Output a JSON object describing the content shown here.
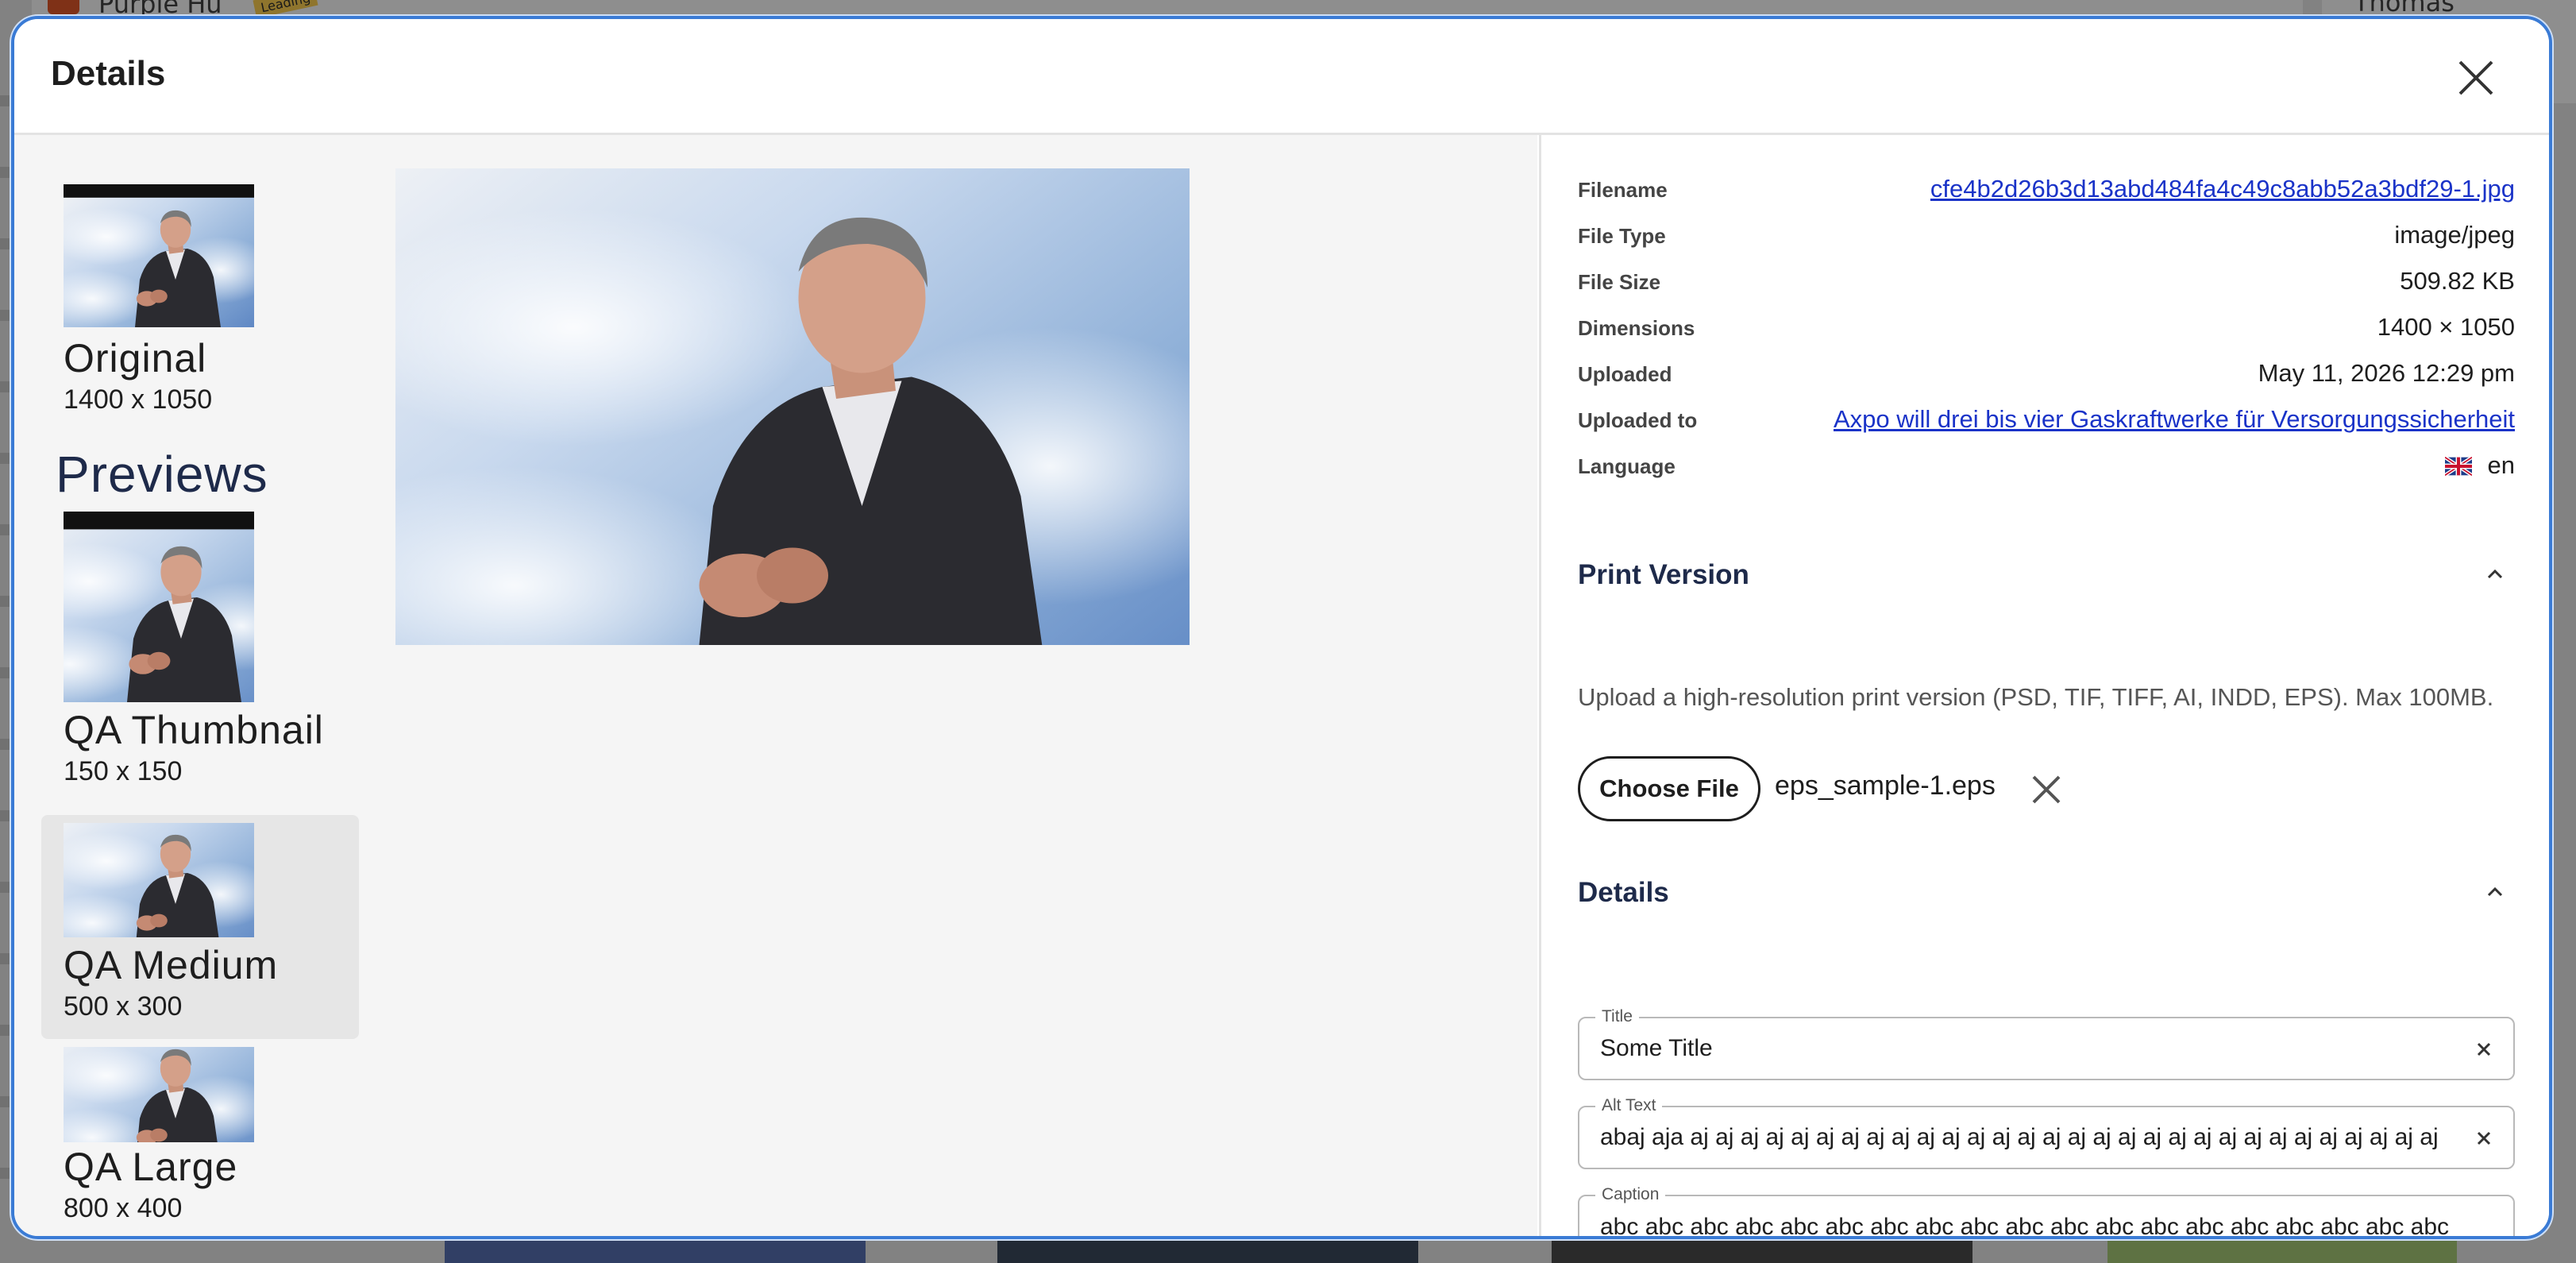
{
  "background": {
    "app_tag": "Purple Hu",
    "badge": "Leading",
    "user_name": "Thomas Beermann"
  },
  "modal": {
    "title": "Details"
  },
  "sizes": {
    "original": {
      "name": "Original",
      "dims": "1400 x 1050"
    },
    "previews_heading": "Previews",
    "previews": [
      {
        "name": "QA Thumbnail",
        "dims": "150 x 150"
      },
      {
        "name": "QA Medium",
        "dims": "500 x 300"
      },
      {
        "name": "QA Large",
        "dims": "800 x 400"
      }
    ]
  },
  "meta": {
    "filename_label": "Filename",
    "filename_value": "cfe4b2d26b3d13abd484fa4c49c8abb52a3bdf29-1.jpg",
    "filetype_label": "File Type",
    "filetype_value": "image/jpeg",
    "filesize_label": "File Size",
    "filesize_value": "509.82 KB",
    "dimensions_label": "Dimensions",
    "dimensions_value": "1400 × 1050",
    "uploaded_label": "Uploaded",
    "uploaded_value": "May 11, 2026 12:29 pm",
    "uploaded_to_label": "Uploaded to",
    "uploaded_to_value": "Axpo will drei bis vier Gaskraftwerke für Versorgungssicherheit",
    "language_label": "Language",
    "language_value": "en"
  },
  "print_version": {
    "title": "Print Version",
    "description": "Upload a high-resolution print version (PSD, TIF, TIFF, AI, INDD, EPS). Max 100MB.",
    "choose_label": "Choose File",
    "file_name": "eps_sample-1.eps"
  },
  "details": {
    "title": "Details",
    "title_field_label": "Title",
    "title_field_value": "Some Title",
    "alt_label": "Alt Text",
    "alt_value": "abaj aja aj aj aj aj aj aj aj aj aj aj aj aj aj aj aj aj aj aj aj aj aj aj aj aj aj aj aj aj aj aj aj aj",
    "caption_label": "Caption",
    "caption_value": "abc abc abc abc abc abc abc abc abc abc abc abc abc abc abc abc abc abc abc abc abc abc abc abc abc abc abcb abc abcb"
  },
  "colors": {
    "modal_border": "#3a7bd5",
    "link": "#1a33c8",
    "heading": "#1e2a4a",
    "selected_item_bg": "#e6e6e6"
  }
}
